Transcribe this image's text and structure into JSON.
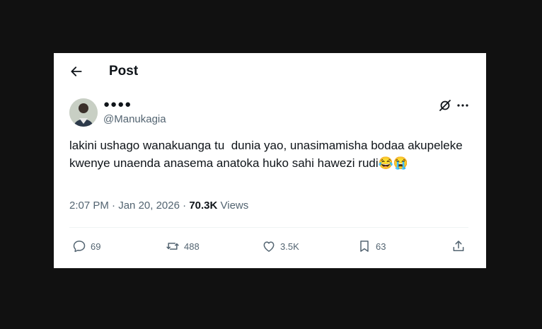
{
  "header": {
    "title": "Post"
  },
  "author": {
    "display_name": "●●●●",
    "handle": "@Manukagia"
  },
  "tweet": {
    "text": "lakini ushago wanakuanga tu  dunia yao, unasimamisha bodaa akupeleke kwenye unaenda anasema anatoka huko sahi hawezi rudi😂😭",
    "time": "2:07 PM",
    "date": "Jan 20, 2026",
    "separator": "·",
    "views_count": "70.3K",
    "views_label": "Views"
  },
  "actions": {
    "replies": "69",
    "reposts": "488",
    "likes": "3.5K",
    "bookmarks": "63"
  },
  "icons": {
    "back": "arrow-left-icon",
    "grok": "grok-icon",
    "more": "more-horizontal-icon",
    "reply": "reply-icon",
    "repost": "repost-icon",
    "like": "heart-icon",
    "bookmark": "bookmark-icon",
    "share": "share-icon"
  },
  "colors": {
    "text": "#0f1419",
    "secondary": "#536471",
    "divider": "#eff3f4",
    "background": "#111111"
  }
}
